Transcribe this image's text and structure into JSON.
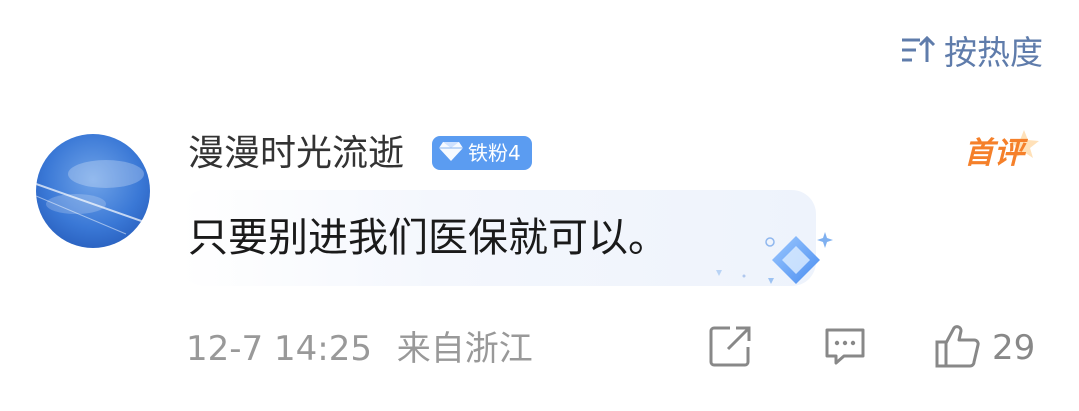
{
  "sort": {
    "label": "按热度"
  },
  "comment": {
    "username": "漫漫时光流逝",
    "fan_badge": "铁粉4",
    "first_label": "首评",
    "text": "只要别进我们医保就可以。",
    "time": "12-7 14:25",
    "location": "来自浙江",
    "like_count": "29"
  },
  "colors": {
    "accent": "#5f7cab",
    "badge": "#5b9cf1",
    "first_label": "#f5802a"
  }
}
